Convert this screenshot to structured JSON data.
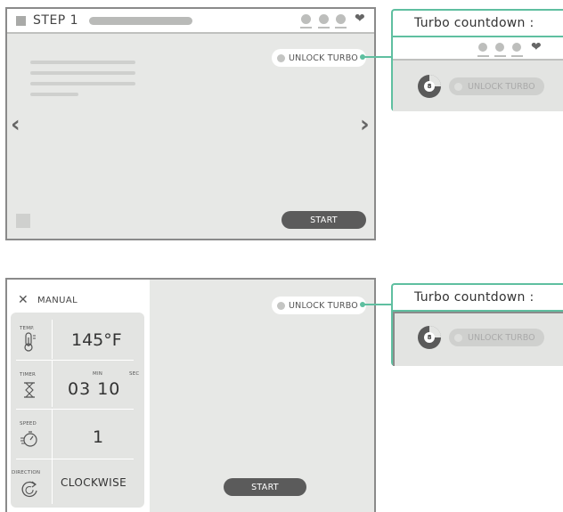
{
  "screen1": {
    "title": "STEP 1",
    "unlock_label": "UNLOCK TURBO",
    "start_label": "START",
    "prev_icon": "chevron-left-icon",
    "next_icon": "chevron-right-icon",
    "header_icons": [
      "profile-icon",
      "profile-icon",
      "profile-icon",
      "heart-icon"
    ]
  },
  "callout1": {
    "title": "Turbo countdown :",
    "countdown": "8",
    "unlock_label": "UNLOCK TURBO"
  },
  "screen2": {
    "mode_label": "MANUAL",
    "unlock_label": "UNLOCK TURBO",
    "start_label": "START",
    "params": [
      {
        "label": "TEMP.",
        "value": "145°F",
        "icon": "thermometer-icon"
      },
      {
        "label": "TIMER",
        "min_label": "MIN",
        "sec_label": "SEC",
        "value": "03 10",
        "icon": "hourglass-icon"
      },
      {
        "label": "SPEED",
        "value": "1",
        "icon": "speed-icon"
      },
      {
        "label": "DIRECTION",
        "value": "CLOCKWISE",
        "icon": "rotate-icon"
      }
    ]
  },
  "callout2": {
    "title": "Turbo countdown :",
    "countdown": "8",
    "unlock_label": "UNLOCK TURBO"
  },
  "colors": {
    "accent": "#5fbfa0",
    "button": "#5b5b5b",
    "panel": "#e7e8e6"
  }
}
